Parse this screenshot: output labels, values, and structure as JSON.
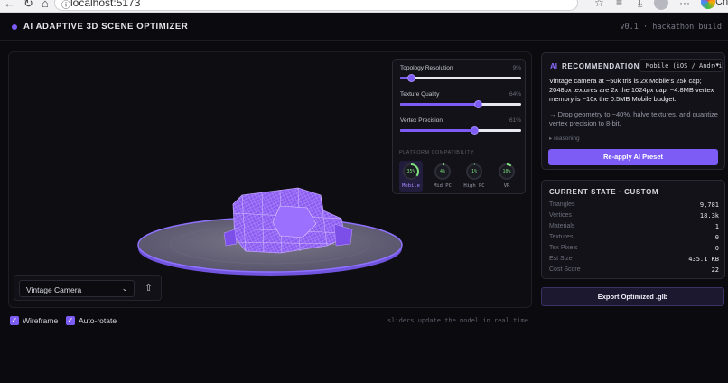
{
  "browser": {
    "url": "localhost:5173",
    "profile_label": "Chr"
  },
  "header": {
    "title": "AI ADAPTIVE 3D SCENE OPTIMIZER",
    "version": "v0.1 · hackathon build"
  },
  "sliders": [
    {
      "label": "Topology Resolution",
      "value_text": "9%",
      "value": 9
    },
    {
      "label": "Texture Quality",
      "value_text": "64%",
      "value": 64
    },
    {
      "label": "Vertex Precision",
      "value_text": "61%",
      "value": 61
    }
  ],
  "platform_compat": {
    "title": "PLATFORM COMPATIBILITY",
    "items": [
      {
        "name": "Mobile",
        "pct_text": "35%",
        "pct": 35,
        "active": true
      },
      {
        "name": "Mid PC",
        "pct_text": "4%",
        "pct": 4,
        "active": false
      },
      {
        "name": "High PC",
        "pct_text": "1%",
        "pct": 1,
        "active": false
      },
      {
        "name": "VR",
        "pct_text": "10%",
        "pct": 10,
        "active": false
      }
    ]
  },
  "model_select": {
    "value": "Vintage Camera"
  },
  "toggles": {
    "wireframe": "Wireframe",
    "autorotate": "Auto-rotate"
  },
  "hint": "sliders update the model in real time",
  "recommendation": {
    "ai_badge": "AI",
    "title": "RECOMMENDATION",
    "platform": "Mobile (iOS / Android)",
    "body": "Vintage camera at ~50k tris is 2x Mobile's 25k cap; 2048px textures are 2x the 1024px cap; ~4.8MB vertex memory is ~10x the 0.5MB Mobile budget.",
    "action": "→ Drop geometry to ~40%, halve textures, and quantize vertex precision to 8-bit.",
    "reasoning": "▸ reasoning",
    "button": "Re-apply AI Preset"
  },
  "current_state": {
    "title": "CURRENT STATE · CUSTOM",
    "rows": [
      {
        "k": "Triangles",
        "v": "9,781"
      },
      {
        "k": "Vertices",
        "v": "18.3k"
      },
      {
        "k": "Materials",
        "v": "1"
      },
      {
        "k": "Textures",
        "v": "0"
      },
      {
        "k": "Tex Pixels",
        "v": "0"
      },
      {
        "k": "Est Size",
        "v": "435.1 KB"
      },
      {
        "k": "Cost Score",
        "v": "22"
      }
    ]
  },
  "export_button": "Export Optimized .glb",
  "colors": {
    "accent": "#7c5cf5",
    "background": "#0b0b0f",
    "panel": "#121218",
    "ok": "#7fe07f"
  }
}
